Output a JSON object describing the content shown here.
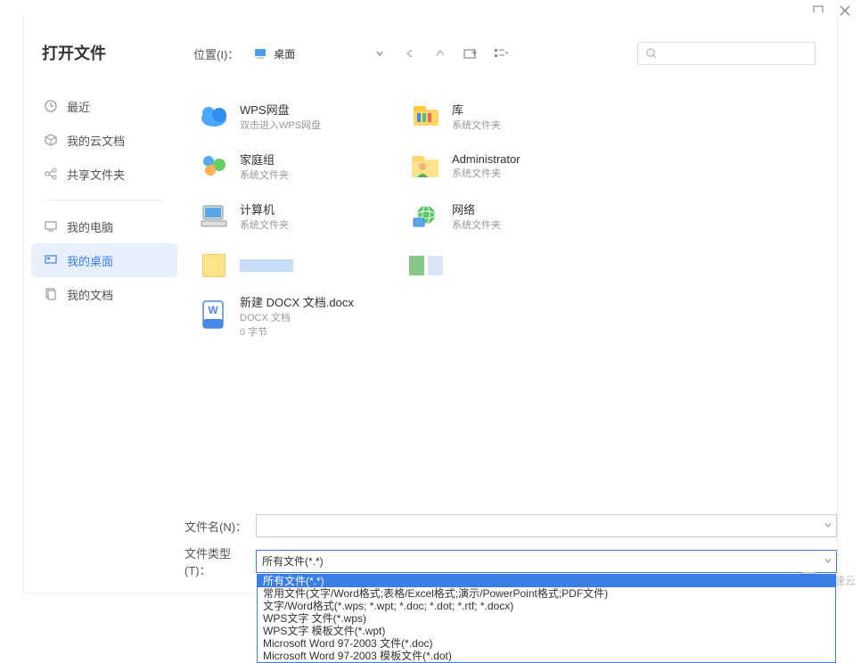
{
  "dialog_title": "打开文件",
  "sidebar": {
    "groups": [
      [
        {
          "icon": "clock",
          "label": "最近"
        },
        {
          "icon": "cube",
          "label": "我的云文档"
        },
        {
          "icon": "share",
          "label": "共享文件夹"
        }
      ],
      [
        {
          "icon": "monitor",
          "label": "我的电脑"
        },
        {
          "icon": "desktop",
          "label": "我的桌面",
          "active": true
        },
        {
          "icon": "docs",
          "label": "我的文档"
        }
      ]
    ]
  },
  "toolbar": {
    "location_label": "位置(I)：",
    "location_value": "桌面"
  },
  "files": [
    {
      "icon": "cloud",
      "name": "WPS网盘",
      "sub": "双击进入WPS网盘"
    },
    {
      "icon": "library",
      "name": "库",
      "sub": "系统文件夹"
    },
    {
      "icon": "homegroup",
      "name": "家庭组",
      "sub": "系统文件夹"
    },
    {
      "icon": "userfolder",
      "name": "Administrator",
      "sub": "系统文件夹"
    },
    {
      "icon": "computer",
      "name": "计算机",
      "sub": "系统文件夹"
    },
    {
      "icon": "network",
      "name": "网络",
      "sub": "系统文件夹"
    },
    {
      "icon": "blank",
      "name": "",
      "sub": ""
    },
    {
      "icon": "blank2",
      "name": "",
      "sub": ""
    },
    {
      "icon": "docx",
      "name": "新建 DOCX 文档.docx",
      "sub": "DOCX 文档",
      "sub2": "0 字节"
    }
  ],
  "filename_label": "文件名(N)：",
  "filetype_label": "文件类型(T)：",
  "filetype_value": "所有文件(*.*)",
  "filetype_options": [
    "所有文件(*.*)",
    "常用文件(文字/Word格式;表格/Excel格式;演示/PowerPoint格式;PDF文件)",
    "文字/Word格式(*.wps; *.wpt; *.doc; *.dot; *.rtf; *.docx)",
    "WPS文字 文件(*.wps)",
    "WPS文字 模板文件(*.wpt)",
    "Microsoft Word 97-2003 文件(*.doc)",
    "Microsoft Word 97-2003 模板文件(*.dot)"
  ],
  "watermark": "亿速云"
}
